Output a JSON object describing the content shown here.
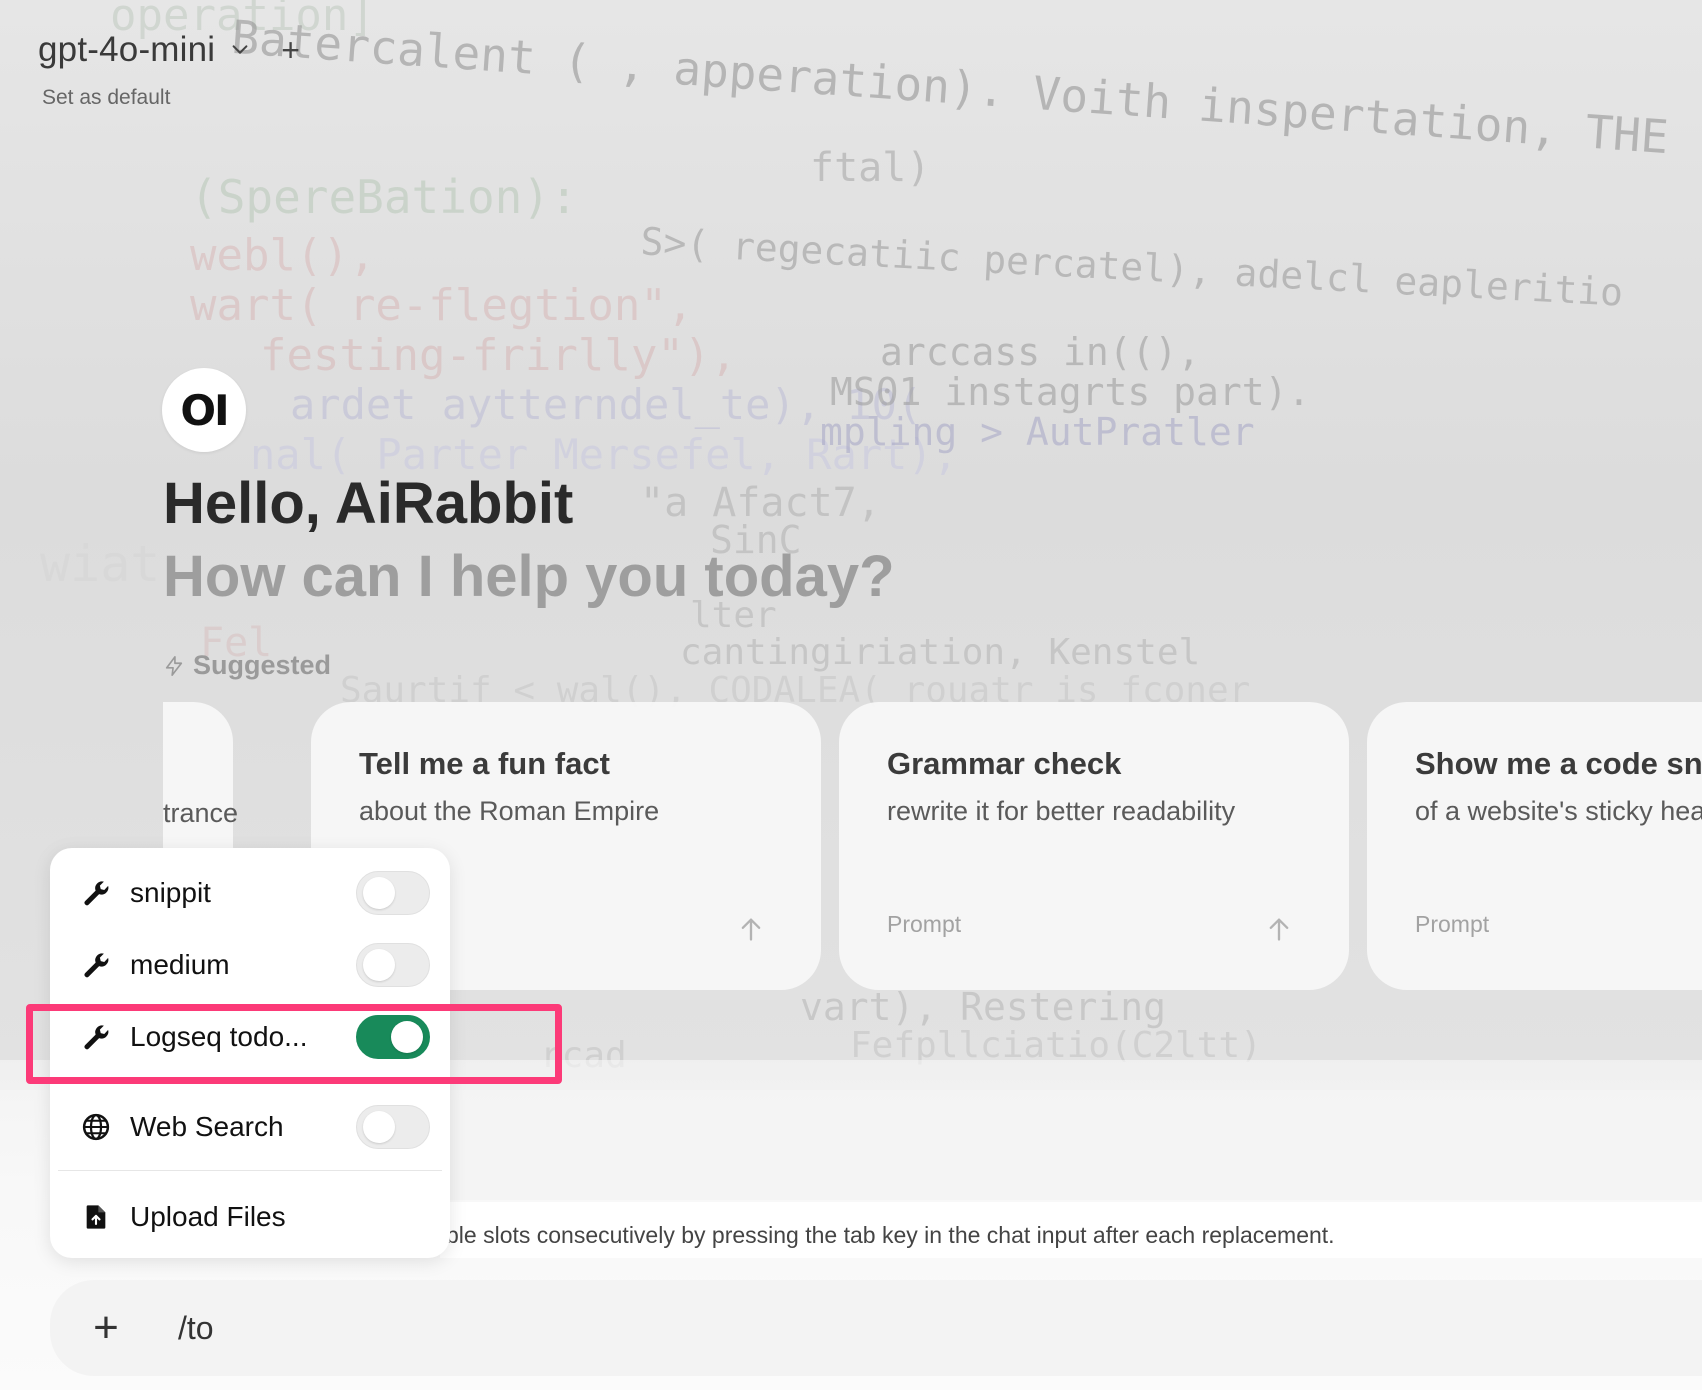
{
  "header": {
    "model_name": "gpt-4o-mini",
    "set_default_label": "Set as default",
    "add_model_symbol": "+"
  },
  "hero": {
    "logo_text": "OI",
    "greeting": "Hello, AiRabbit",
    "subtitle": "How can I help you today?",
    "suggested_label": "Suggested"
  },
  "suggestions": [
    {
      "title": "",
      "subtitle": "trance",
      "prompt_label": ""
    },
    {
      "title": "Tell me a fun fact",
      "subtitle": "about the Roman Empire",
      "prompt_label": ""
    },
    {
      "title": "Grammar check",
      "subtitle": "rewrite it for better readability",
      "prompt_label": "Prompt"
    },
    {
      "title": "Show me a code sni",
      "subtitle": "of a website's sticky hea",
      "prompt_label": "Prompt"
    }
  ],
  "tools_menu": {
    "items": [
      {
        "label": "snippit",
        "icon": "wrench-icon",
        "enabled": false
      },
      {
        "label": "medium",
        "icon": "wrench-icon",
        "enabled": false
      },
      {
        "label": "Logseq todo...",
        "icon": "wrench-icon",
        "enabled": true
      },
      {
        "label": "Web Search",
        "icon": "globe-icon",
        "enabled": false
      }
    ],
    "upload_label": "Upload Files",
    "upload_icon": "file-upload-icon"
  },
  "chat": {
    "hint_text": "ble slots consecutively by pressing the tab key in the chat input after each replacement.",
    "input_value": "/to",
    "plus_symbol": "+"
  },
  "colors": {
    "toggle_on": "#188a5a",
    "highlight": "#fc3a78"
  },
  "background_code": [
    "operation]",
    "Batercalent ( , apperation). Voith inspertation, THE",
    "ftal)",
    "(SpereBation):",
    "webl(),",
    "wart( re-flegtion\",",
    "S>( regecatiic percatel), adelcl eapleritio",
    "festing-frirlly\"),",
    "arccass in((),",
    "ardet aytterndel_te), 10(",
    "MS01 instagrts part).",
    "nal( Parter Mersefel, Rart),",
    "mpling > AutPratler",
    "\"a Afact7,",
    "SinC",
    "wiat",
    "lter",
    "Fel",
    "cantingiriation, Kenstel",
    "Saurtif < wal(), CODALEA( rouatr is fconer",
    "vart), Restering",
    "Fefpllciatio(C2ltt)",
    "rcad"
  ]
}
